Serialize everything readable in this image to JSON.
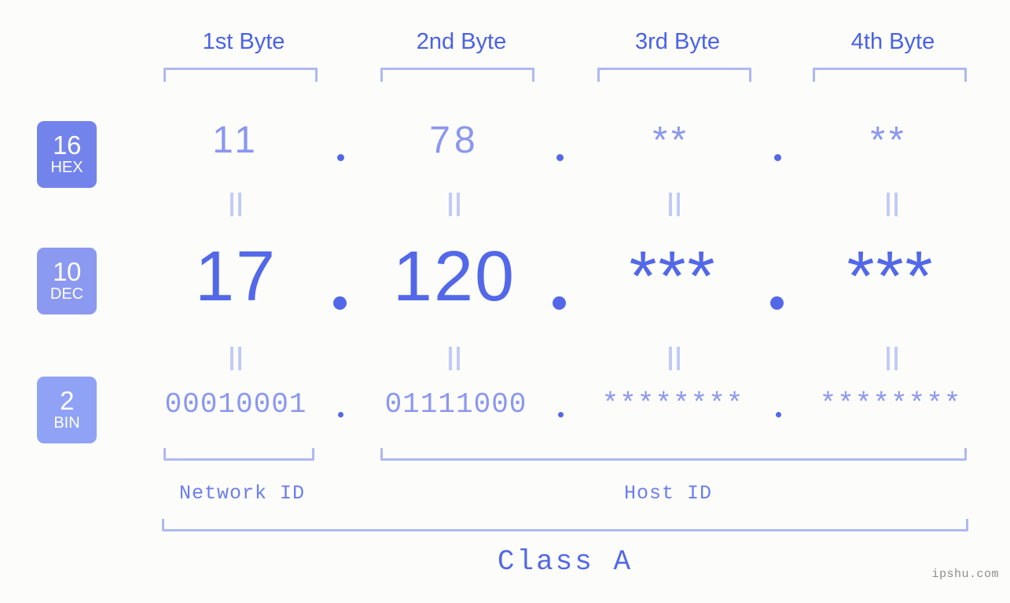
{
  "background": "#fcfdfa",
  "colors": {
    "bracket": "#aeb8f4",
    "header_label": "#4a61ea",
    "hex_value": "#8b97f0",
    "dec_value": "#5368e8",
    "bin_value": "#8b97f0",
    "dot": "#5368e8",
    "equals_bar": "#c2cbf7",
    "badge_hex": "#7383ec",
    "badge_dec": "#8b99f0",
    "badge_bin": "#8fa2f5",
    "section_label": "#6c7df0",
    "class_label": "#5368e8",
    "watermark": "#8d8d8d"
  },
  "headers": [
    {
      "label": "1st Byte"
    },
    {
      "label": "2nd Byte"
    },
    {
      "label": "3rd Byte"
    },
    {
      "label": "4th Byte"
    }
  ],
  "bases": [
    {
      "num": "16",
      "name": "HEX"
    },
    {
      "num": "10",
      "name": "DEC"
    },
    {
      "num": "2",
      "name": "BIN"
    }
  ],
  "separator": ".",
  "equals_symbol": "||",
  "rows": {
    "hex": {
      "base_num": "16",
      "base_name": "HEX",
      "values": [
        "11",
        "78",
        "**",
        "**"
      ]
    },
    "dec": {
      "base_num": "10",
      "base_name": "DEC",
      "values": [
        "17",
        "120",
        "***",
        "***"
      ]
    },
    "bin": {
      "base_num": "2",
      "base_name": "BIN",
      "values": [
        "00010001",
        "01111000",
        "********",
        "********"
      ]
    }
  },
  "sections": [
    {
      "label": "Network ID"
    },
    {
      "label": "Host ID"
    }
  ],
  "class": {
    "label": "Class A"
  },
  "watermark": {
    "text": "ipshu.com"
  }
}
